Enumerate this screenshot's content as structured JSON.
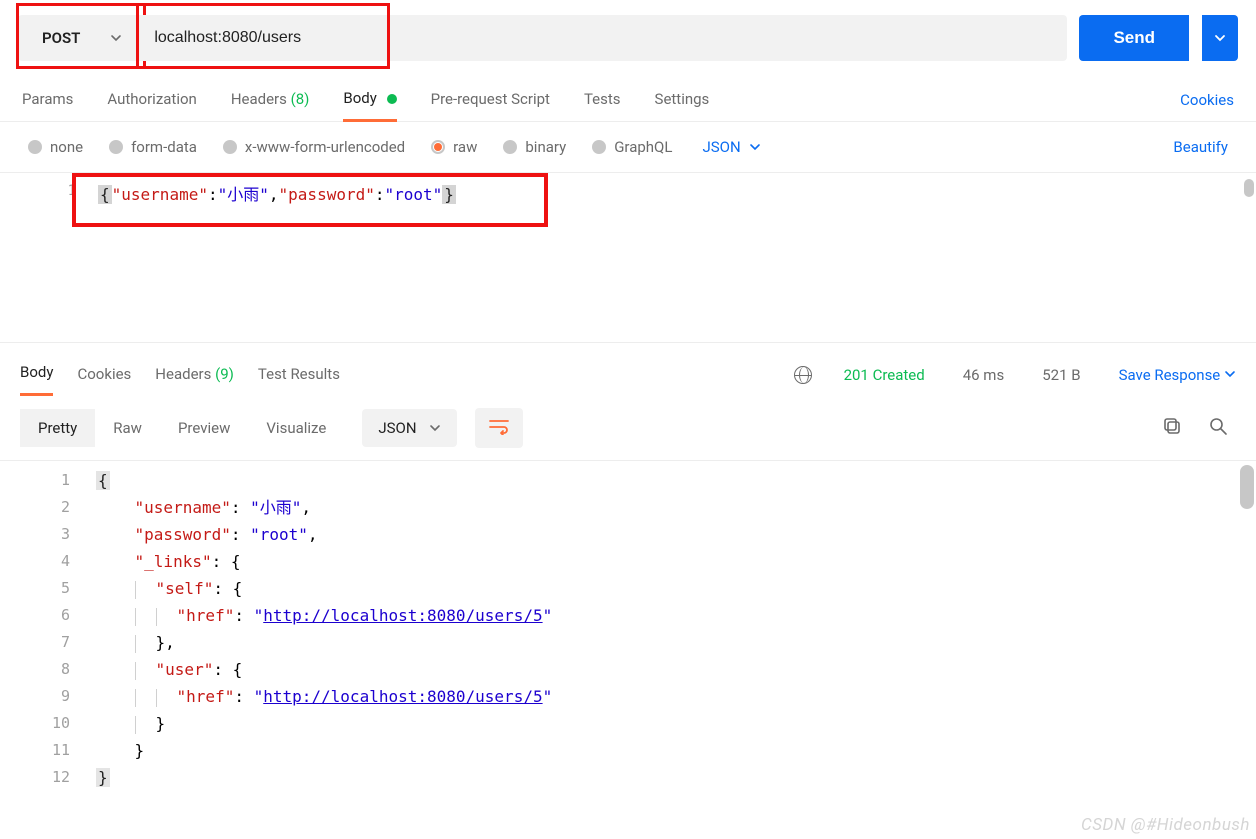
{
  "request": {
    "method": "POST",
    "url": "localhost:8080/users",
    "send_label": "Send"
  },
  "tabs": {
    "params": "Params",
    "authorization": "Authorization",
    "headers_label": "Headers",
    "headers_count": "(8)",
    "body": "Body",
    "prerequest": "Pre-request Script",
    "tests": "Tests",
    "settings": "Settings",
    "cookies": "Cookies"
  },
  "body_types": {
    "none": "none",
    "form_data": "form-data",
    "xform": "x-www-form-urlencoded",
    "raw": "raw",
    "binary": "binary",
    "graphql": "GraphQL",
    "format": "JSON",
    "beautify": "Beautify"
  },
  "request_body": {
    "line_no": "1",
    "key_username": "\"username\"",
    "val_username": "\"小雨\"",
    "key_password": "\"password\"",
    "val_password": "\"root\""
  },
  "response_tabs": {
    "body": "Body",
    "cookies": "Cookies",
    "headers_label": "Headers",
    "headers_count": "(9)",
    "test_results": "Test Results"
  },
  "response_meta": {
    "status": "201 Created",
    "time": "46 ms",
    "size": "521 B",
    "save": "Save Response"
  },
  "view_modes": {
    "pretty": "Pretty",
    "raw": "Raw",
    "preview": "Preview",
    "visualize": "Visualize",
    "format": "JSON"
  },
  "response_body": {
    "lines": [
      "1",
      "2",
      "3",
      "4",
      "5",
      "6",
      "7",
      "8",
      "9",
      "10",
      "11",
      "12"
    ],
    "k_username": "\"username\"",
    "v_username": "\"小雨\"",
    "k_password": "\"password\"",
    "v_password": "\"root\"",
    "k_links": "\"_links\"",
    "k_self": "\"self\"",
    "k_href": "\"href\"",
    "v_href": "http://localhost:8080/users/5",
    "k_user": "\"user\""
  },
  "watermark": "CSDN @#Hideonbush"
}
